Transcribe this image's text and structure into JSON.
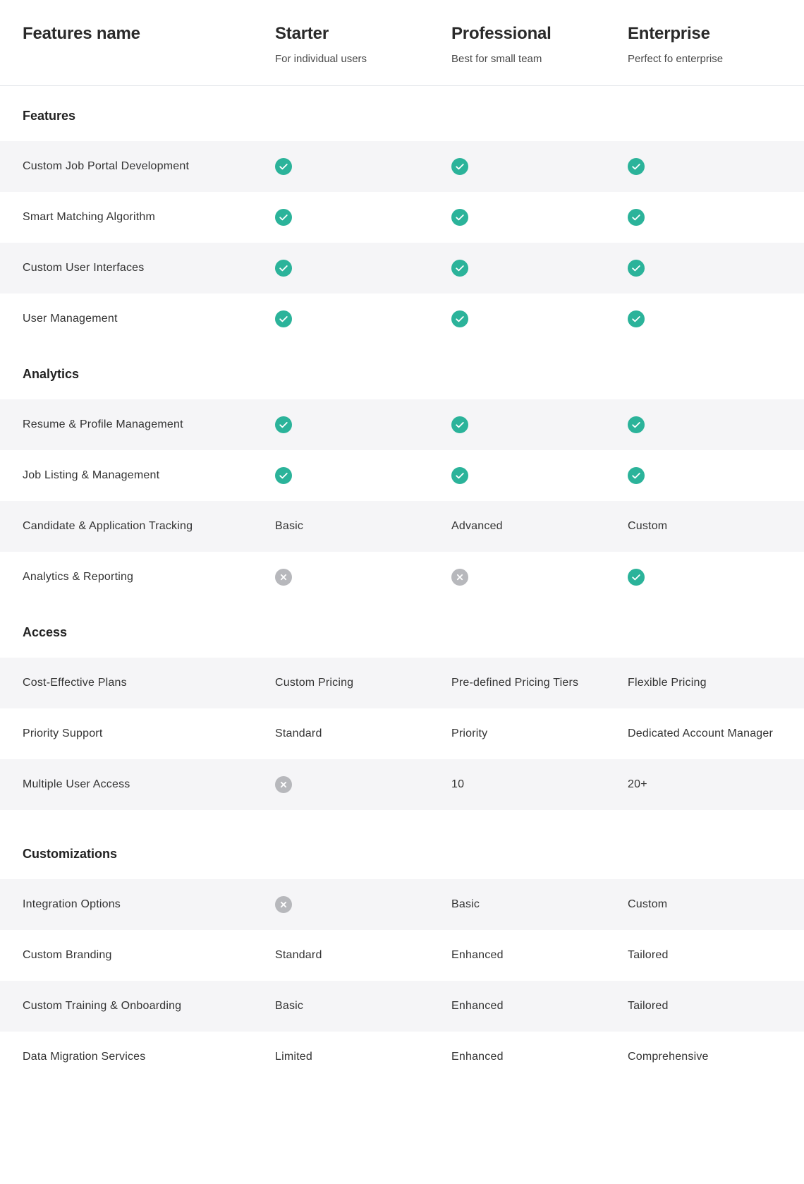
{
  "header": {
    "features_name": "Features name",
    "plans": [
      {
        "name": "Starter",
        "subtitle": "For individual users"
      },
      {
        "name": "Professional",
        "subtitle": "Best for small team"
      },
      {
        "name": "Enterprise",
        "subtitle": "Perfect fo enterprise"
      }
    ]
  },
  "colors": {
    "check": "#2bb39a",
    "cross": "#b7b8bc",
    "row_shade": "#f5f5f7"
  },
  "sections": [
    {
      "title": "Features",
      "rows": [
        {
          "name": "Custom Job Portal Development",
          "values": [
            {
              "icon": "check-icon"
            },
            {
              "icon": "check-icon"
            },
            {
              "icon": "check-icon"
            }
          ]
        },
        {
          "name": "Smart Matching Algorithm",
          "values": [
            {
              "icon": "check-icon"
            },
            {
              "icon": "check-icon"
            },
            {
              "icon": "check-icon"
            }
          ]
        },
        {
          "name": "Custom User Interfaces",
          "values": [
            {
              "icon": "check-icon"
            },
            {
              "icon": "check-icon"
            },
            {
              "icon": "check-icon"
            }
          ]
        },
        {
          "name": "User Management",
          "values": [
            {
              "icon": "check-icon"
            },
            {
              "icon": "check-icon"
            },
            {
              "icon": "check-icon"
            }
          ]
        }
      ]
    },
    {
      "title": "Analytics",
      "rows": [
        {
          "name": "Resume & Profile Management",
          "values": [
            {
              "icon": "check-icon"
            },
            {
              "icon": "check-icon"
            },
            {
              "icon": "check-icon"
            }
          ]
        },
        {
          "name": "Job Listing & Management",
          "values": [
            {
              "icon": "check-icon"
            },
            {
              "icon": "check-icon"
            },
            {
              "icon": "check-icon"
            }
          ]
        },
        {
          "name": "Candidate & Application Tracking",
          "values": [
            {
              "text": "Basic"
            },
            {
              "text": "Advanced"
            },
            {
              "text": "Custom"
            }
          ]
        },
        {
          "name": "Analytics & Reporting",
          "values": [
            {
              "icon": "cross-icon"
            },
            {
              "icon": "cross-icon"
            },
            {
              "icon": "check-icon"
            }
          ]
        }
      ]
    },
    {
      "title": "Access",
      "rows": [
        {
          "name": "Cost-Effective Plans",
          "values": [
            {
              "text": "Custom Pricing"
            },
            {
              "text": "Pre-defined Pricing Tiers"
            },
            {
              "text": "Flexible Pricing"
            }
          ]
        },
        {
          "name": "Priority Support",
          "values": [
            {
              "text": "Standard"
            },
            {
              "text": "Priority"
            },
            {
              "text": "Dedicated Account Manager"
            }
          ]
        },
        {
          "name": "Multiple User Access",
          "values": [
            {
              "icon": "cross-icon"
            },
            {
              "text": "10"
            },
            {
              "text": "20+"
            }
          ]
        }
      ]
    },
    {
      "title": "Customizations",
      "rows": [
        {
          "name": "Integration Options",
          "values": [
            {
              "icon": "cross-icon"
            },
            {
              "text": "Basic"
            },
            {
              "text": "Custom"
            }
          ]
        },
        {
          "name": "Custom Branding",
          "values": [
            {
              "text": "Standard"
            },
            {
              "text": "Enhanced"
            },
            {
              "text": "Tailored"
            }
          ]
        },
        {
          "name": "Custom Training & Onboarding",
          "values": [
            {
              "text": "Basic"
            },
            {
              "text": "Enhanced"
            },
            {
              "text": "Tailored"
            }
          ]
        },
        {
          "name": "Data Migration Services",
          "values": [
            {
              "text": "Limited"
            },
            {
              "text": "Enhanced"
            },
            {
              "text": "Comprehensive"
            }
          ]
        }
      ]
    }
  ]
}
